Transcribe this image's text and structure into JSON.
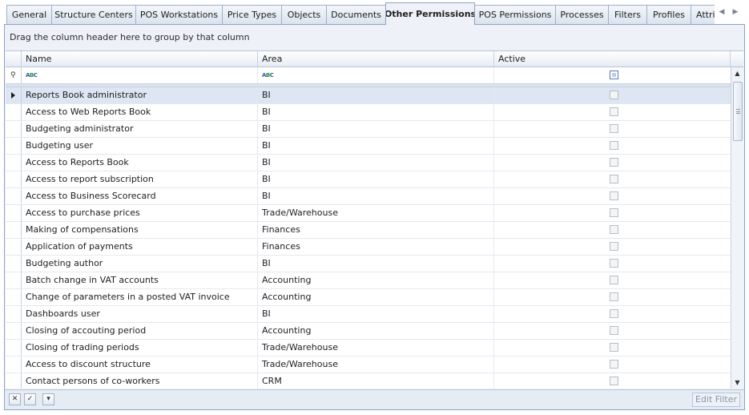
{
  "tabs": [
    {
      "label": "General",
      "active": false
    },
    {
      "label": "Structure Centers",
      "active": false
    },
    {
      "label": "POS Workstations",
      "active": false
    },
    {
      "label": "Price Types",
      "active": false
    },
    {
      "label": "Objects",
      "active": false
    },
    {
      "label": "Documents",
      "active": false
    },
    {
      "label": "Other Permissions",
      "active": true
    },
    {
      "label": "POS Permissions",
      "active": false
    },
    {
      "label": "Processes",
      "active": false
    },
    {
      "label": "Filters",
      "active": false
    },
    {
      "label": "Profiles",
      "active": false
    },
    {
      "label": "Attri",
      "active": false
    }
  ],
  "tab_nav": {
    "prev": "◀",
    "next": "▶"
  },
  "group_area": {
    "hint": "Drag the column header here to group by that column"
  },
  "columns": {
    "name": "Name",
    "area": "Area",
    "active": "Active"
  },
  "filter_row": {
    "name_icon": "abc-filter-icon",
    "area_icon": "abc-filter-icon",
    "abc_a": "A",
    "abc_b": "B",
    "abc_c": "C"
  },
  "rows": [
    {
      "name": "Reports Book administrator",
      "area": "BI",
      "active": false,
      "selected": true
    },
    {
      "name": "Access to Web Reports Book",
      "area": "BI",
      "active": false
    },
    {
      "name": "Budgeting administrator",
      "area": "BI",
      "active": false
    },
    {
      "name": "Budgeting user",
      "area": "BI",
      "active": false
    },
    {
      "name": "Access to Reports Book",
      "area": "BI",
      "active": false
    },
    {
      "name": "Access to report subscription",
      "area": "BI",
      "active": false
    },
    {
      "name": "Access to Business Scorecard",
      "area": "BI",
      "active": false
    },
    {
      "name": "Access to purchase prices",
      "area": "Trade/Warehouse",
      "active": false
    },
    {
      "name": "Making of compensations",
      "area": "Finances",
      "active": false
    },
    {
      "name": "Application of payments",
      "area": "Finances",
      "active": false
    },
    {
      "name": "Budgeting author",
      "area": "BI",
      "active": false
    },
    {
      "name": "Batch change in VAT accounts",
      "area": "Accounting",
      "active": false
    },
    {
      "name": "Change of parameters in a posted VAT invoice",
      "area": "Accounting",
      "active": false
    },
    {
      "name": "Dashboards user",
      "area": "BI",
      "active": false
    },
    {
      "name": "Closing of accouting period",
      "area": "Accounting",
      "active": false
    },
    {
      "name": "Closing of trading periods",
      "area": "Trade/Warehouse",
      "active": false
    },
    {
      "name": "Access to discount structure",
      "area": "Trade/Warehouse",
      "active": false
    },
    {
      "name": "Contact persons of co-workers",
      "area": "CRM",
      "active": false
    }
  ],
  "scrollbar": {
    "up": "▲",
    "down": "▼"
  },
  "footer": {
    "clear_filter_glyph": "✕",
    "check_glyph": "✓",
    "dropdown_glyph": "▾",
    "edit_filter": "Edit Filter"
  },
  "colors": {
    "accent_border": "#8ea3c1",
    "panel_bg": "#eef2f8",
    "selected_row": "#dde6f2"
  }
}
